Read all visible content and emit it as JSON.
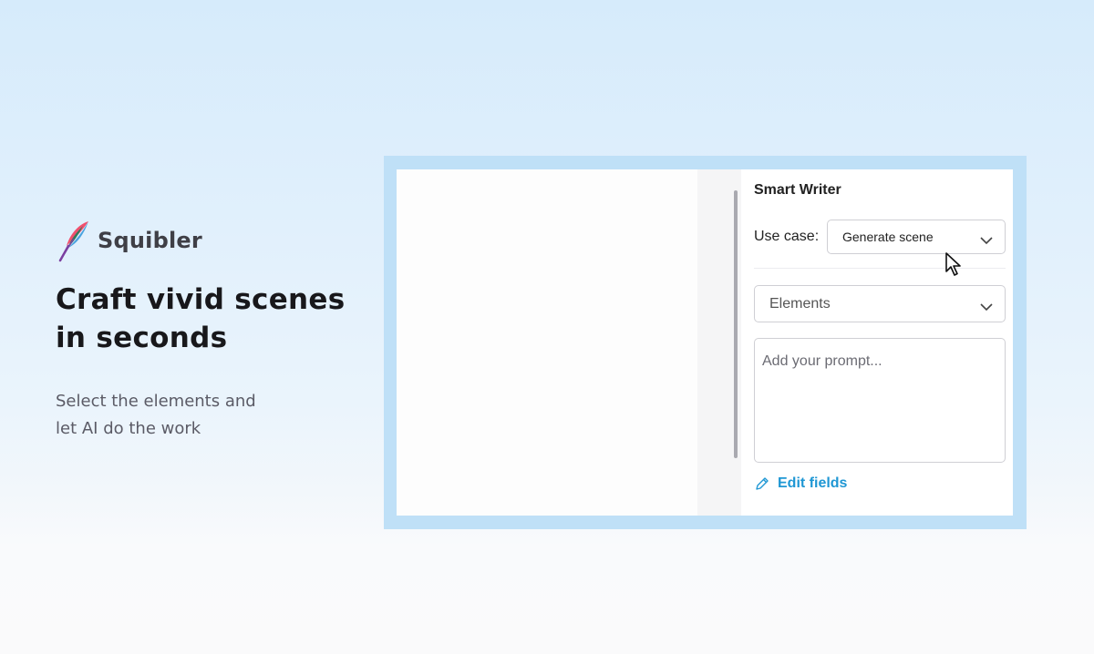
{
  "brand": {
    "name": "Squibler",
    "logo_icon": "feather-quill-icon",
    "logo_colors": [
      "#f0506e",
      "#4aa3df",
      "#7b3fa0",
      "#2e7d5b"
    ]
  },
  "hero": {
    "headline_line1": "Craft vivid scenes",
    "headline_line2": "in seconds",
    "subline_line1": "Select the elements and",
    "subline_line2": "let AI do the work"
  },
  "smart_writer": {
    "title": "Smart Writer",
    "use_case_label": "Use case:",
    "use_case_value": "Generate scene",
    "elements_value": "Elements",
    "prompt_placeholder": "Add your prompt...",
    "edit_fields_label": "Edit fields"
  },
  "colors": {
    "accent": "#1f97d4",
    "frame": "#bfe0f7"
  }
}
